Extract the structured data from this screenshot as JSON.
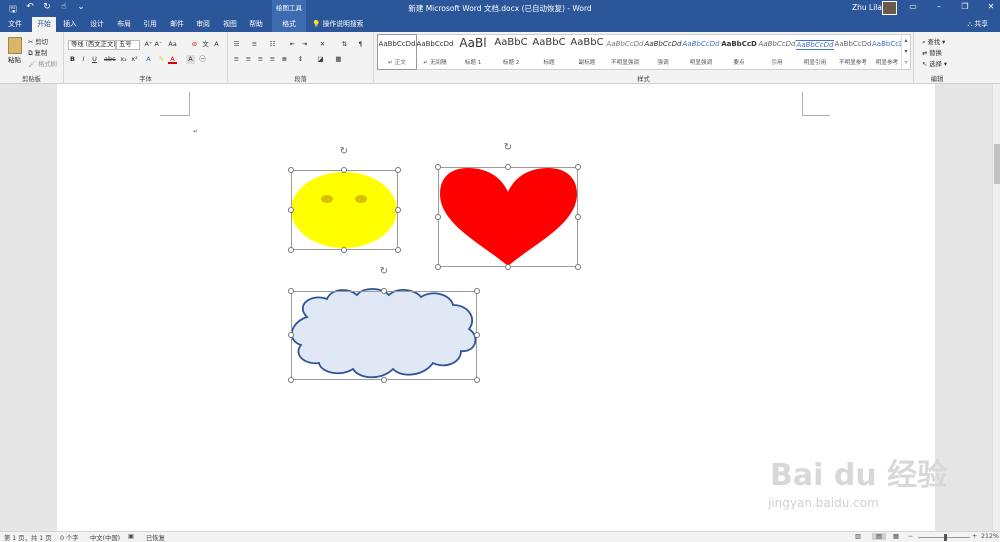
{
  "title_bar": {
    "doc_title": "新建 Microsoft Word 文档.docx (已自动恢复)  -  Word",
    "contextual_tab_group": "绘图工具",
    "user_name": "Zhu Lilan"
  },
  "tabs": [
    {
      "label": "文件"
    },
    {
      "label": "开始"
    },
    {
      "label": "插入"
    },
    {
      "label": "设计"
    },
    {
      "label": "布局"
    },
    {
      "label": "引用"
    },
    {
      "label": "邮件"
    },
    {
      "label": "审阅"
    },
    {
      "label": "视图"
    },
    {
      "label": "帮助"
    },
    {
      "label": "格式"
    }
  ],
  "tell_me": "操作说明搜索",
  "share": "共享",
  "ribbon": {
    "clipboard": {
      "label": "剪贴板",
      "paste": "粘贴",
      "cut": "剪切",
      "copy": "复制",
      "format_painter": "格式刷"
    },
    "font": {
      "label": "字体",
      "font_name": "等线 (西文正文)",
      "font_size": "五号"
    },
    "paragraph": {
      "label": "段落"
    },
    "styles": {
      "label": "样式",
      "items": [
        {
          "sample": "AaBbCcDd",
          "name": "↵ 正文"
        },
        {
          "sample": "AaBbCcDd",
          "name": "↵ 无间隔"
        },
        {
          "sample": "AaBl",
          "name": "标题 1"
        },
        {
          "sample": "AaBbC",
          "name": "标题 2"
        },
        {
          "sample": "AaBbC",
          "name": "标题"
        },
        {
          "sample": "AaBbC",
          "name": "副标题"
        },
        {
          "sample": "AaBbCcDd",
          "name": "不明显强调"
        },
        {
          "sample": "AaBbCcDd",
          "name": "强调"
        },
        {
          "sample": "AaBbCcDd",
          "name": "明显强调"
        },
        {
          "sample": "AaBbCcD",
          "name": "要点"
        },
        {
          "sample": "AaBbCcDd",
          "name": "引用"
        },
        {
          "sample": "AaBbCcDd",
          "name": "明显引用"
        },
        {
          "sample": "AaBbCcDd",
          "name": "不明显参考"
        },
        {
          "sample": "AaBbCcDd",
          "name": "明显参考"
        }
      ]
    },
    "editing": {
      "label": "编辑",
      "find": "查找",
      "replace": "替换",
      "select": "选择"
    }
  },
  "shapes": {
    "smiley_color": "#ffff00",
    "heart_color": "#ff0000",
    "cloud_fill": "#dfe8f4",
    "cloud_stroke": "#2f5597"
  },
  "watermark": {
    "brand": "Bai du 经验",
    "url": "jingyan.baidu.com"
  },
  "status_bar": {
    "page": "第 1 页，共 1 页",
    "words": "0 个字",
    "language": "中文(中国)",
    "recovered": "已恢复",
    "zoom": "212%"
  }
}
